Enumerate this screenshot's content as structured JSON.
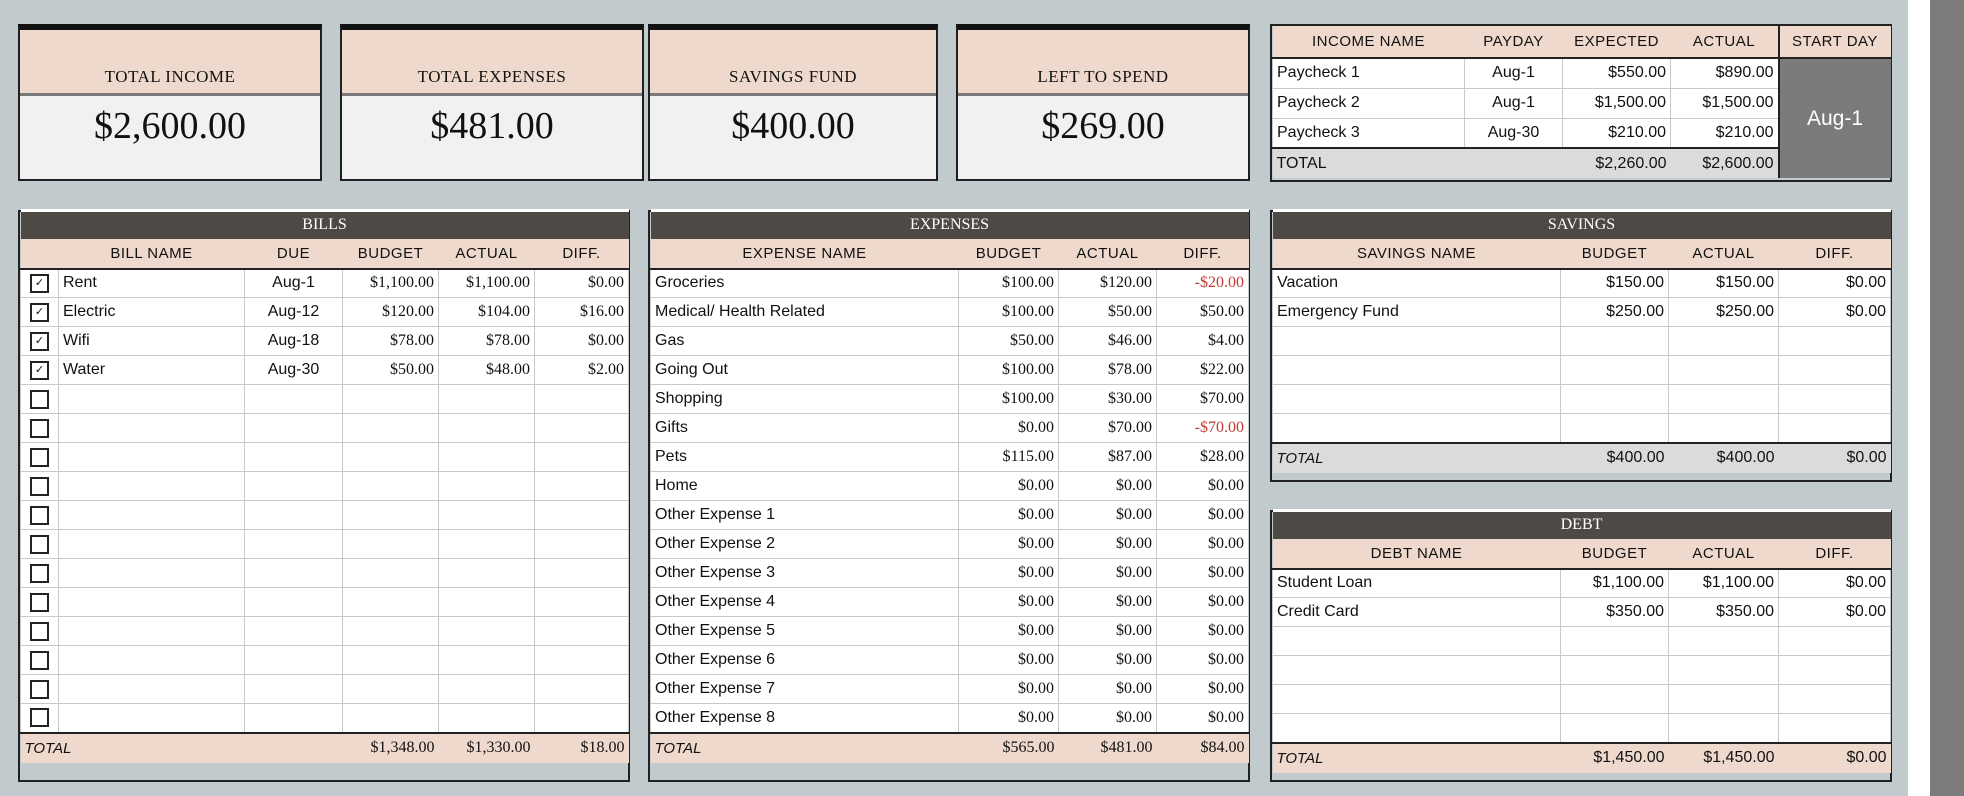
{
  "summary": [
    {
      "title": "TOTAL INCOME",
      "value": "$2,600.00"
    },
    {
      "title": "TOTAL EXPENSES",
      "value": "$481.00"
    },
    {
      "title": "SAVINGS FUND",
      "value": "$400.00"
    },
    {
      "title": "LEFT TO SPEND",
      "value": "$269.00"
    }
  ],
  "income": {
    "headers": [
      "INCOME NAME",
      "PAYDAY",
      "EXPECTED",
      "ACTUAL",
      "START DAY"
    ],
    "rows": [
      {
        "name": "Paycheck 1",
        "payday": "Aug-1",
        "expected": "$550.00",
        "actual": "$890.00"
      },
      {
        "name": "Paycheck 2",
        "payday": "Aug-1",
        "expected": "$1,500.00",
        "actual": "$1,500.00"
      },
      {
        "name": "Paycheck 3",
        "payday": "Aug-30",
        "expected": "$210.00",
        "actual": "$210.00"
      }
    ],
    "start_day": "Aug-1",
    "total": {
      "label": "TOTAL",
      "expected": "$2,260.00",
      "actual": "$2,600.00"
    }
  },
  "bills": {
    "title": "BILLS",
    "headers": [
      "BILL NAME",
      "DUE",
      "BUDGET",
      "ACTUAL",
      "DIFF."
    ],
    "rows": [
      {
        "checked": true,
        "name": "Rent",
        "due": "Aug-1",
        "budget": "$1,100.00",
        "actual": "$1,100.00",
        "diff": "$0.00"
      },
      {
        "checked": true,
        "name": "Electric",
        "due": "Aug-12",
        "budget": "$120.00",
        "actual": "$104.00",
        "diff": "$16.00"
      },
      {
        "checked": true,
        "name": "Wifi",
        "due": "Aug-18",
        "budget": "$78.00",
        "actual": "$78.00",
        "diff": "$0.00"
      },
      {
        "checked": true,
        "name": "Water",
        "due": "Aug-30",
        "budget": "$50.00",
        "actual": "$48.00",
        "diff": "$2.00"
      }
    ],
    "empty_rows": 12,
    "total": {
      "label": "TOTAL",
      "budget": "$1,348.00",
      "actual": "$1,330.00",
      "diff": "$18.00"
    }
  },
  "expenses": {
    "title": "EXPENSES",
    "headers": [
      "EXPENSE NAME",
      "BUDGET",
      "ACTUAL",
      "DIFF."
    ],
    "rows": [
      {
        "name": "Groceries",
        "budget": "$100.00",
        "actual": "$120.00",
        "diff": "-$20.00",
        "neg": true
      },
      {
        "name": "Medical/ Health Related",
        "budget": "$100.00",
        "actual": "$50.00",
        "diff": "$50.00"
      },
      {
        "name": "Gas",
        "budget": "$50.00",
        "actual": "$46.00",
        "diff": "$4.00"
      },
      {
        "name": "Going Out",
        "budget": "$100.00",
        "actual": "$78.00",
        "diff": "$22.00"
      },
      {
        "name": "Shopping",
        "budget": "$100.00",
        "actual": "$30.00",
        "diff": "$70.00"
      },
      {
        "name": "Gifts",
        "budget": "$0.00",
        "actual": "$70.00",
        "diff": "-$70.00",
        "neg": true
      },
      {
        "name": "Pets",
        "budget": "$115.00",
        "actual": "$87.00",
        "diff": "$28.00"
      },
      {
        "name": "Home",
        "budget": "$0.00",
        "actual": "$0.00",
        "diff": "$0.00"
      },
      {
        "name": "Other Expense 1",
        "budget": "$0.00",
        "actual": "$0.00",
        "diff": "$0.00"
      },
      {
        "name": "Other Expense 2",
        "budget": "$0.00",
        "actual": "$0.00",
        "diff": "$0.00"
      },
      {
        "name": "Other Expense 3",
        "budget": "$0.00",
        "actual": "$0.00",
        "diff": "$0.00"
      },
      {
        "name": "Other Expense 4",
        "budget": "$0.00",
        "actual": "$0.00",
        "diff": "$0.00"
      },
      {
        "name": "Other Expense 5",
        "budget": "$0.00",
        "actual": "$0.00",
        "diff": "$0.00"
      },
      {
        "name": "Other Expense 6",
        "budget": "$0.00",
        "actual": "$0.00",
        "diff": "$0.00"
      },
      {
        "name": "Other Expense 7",
        "budget": "$0.00",
        "actual": "$0.00",
        "diff": "$0.00"
      },
      {
        "name": "Other Expense 8",
        "budget": "$0.00",
        "actual": "$0.00",
        "diff": "$0.00"
      }
    ],
    "total": {
      "label": "TOTAL",
      "budget": "$565.00",
      "actual": "$481.00",
      "diff": "$84.00"
    }
  },
  "savings": {
    "title": "SAVINGS",
    "headers": [
      "SAVINGS NAME",
      "BUDGET",
      "ACTUAL",
      "DIFF."
    ],
    "rows": [
      {
        "name": "Vacation",
        "budget": "$150.00",
        "actual": "$150.00",
        "diff": "$0.00"
      },
      {
        "name": "Emergency Fund",
        "budget": "$250.00",
        "actual": "$250.00",
        "diff": "$0.00"
      }
    ],
    "empty_rows": 4,
    "total": {
      "label": "TOTAL",
      "budget": "$400.00",
      "actual": "$400.00",
      "diff": "$0.00"
    }
  },
  "debt": {
    "title": "DEBT",
    "headers": [
      "DEBT NAME",
      "BUDGET",
      "ACTUAL",
      "DIFF."
    ],
    "rows": [
      {
        "name": "Student Loan",
        "budget": "$1,100.00",
        "actual": "$1,100.00",
        "diff": "$0.00"
      },
      {
        "name": "Credit Card",
        "budget": "$350.00",
        "actual": "$350.00",
        "diff": "$0.00"
      }
    ],
    "empty_rows": 4,
    "total": {
      "label": "TOTAL",
      "budget": "$1,450.00",
      "actual": "$1,450.00",
      "diff": "$0.00"
    }
  }
}
